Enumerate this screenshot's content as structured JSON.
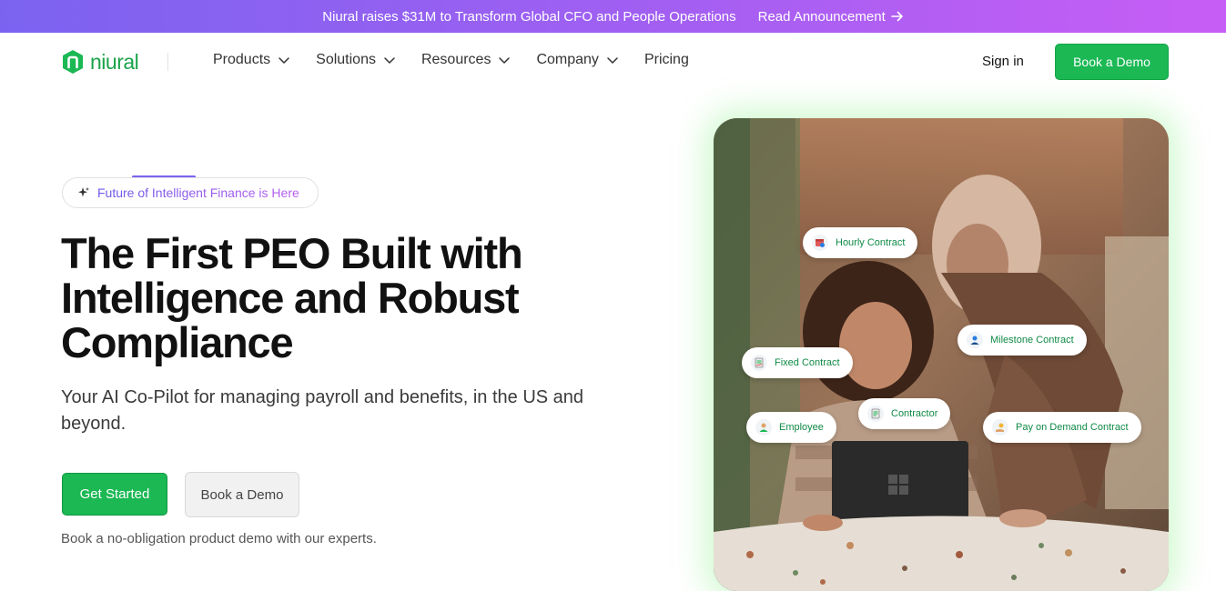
{
  "announcement": {
    "text": "Niural raises $31M to Transform Global CFO and People Operations",
    "link_label": "Read Announcement",
    "link_icon": "arrow-right-icon"
  },
  "nav": {
    "logo_text": "niural",
    "items": [
      {
        "label": "Products",
        "has_dropdown": true
      },
      {
        "label": "Solutions",
        "has_dropdown": true
      },
      {
        "label": "Resources",
        "has_dropdown": true
      },
      {
        "label": "Company",
        "has_dropdown": true
      },
      {
        "label": "Pricing",
        "has_dropdown": false
      }
    ],
    "signin_label": "Sign in",
    "demo_label": "Book a Demo"
  },
  "hero": {
    "badge_text": "Future of Intelligent Finance is Here",
    "badge_icon": "sparkle-icon",
    "title_lines": [
      "The First PEO Built with",
      "Intelligence and Robust",
      "Compliance"
    ],
    "subtitle_lines": [
      "Your AI Co-Pilot for managing payroll and benefits, in the US and",
      "beyond."
    ],
    "primary_cta": "Get Started",
    "secondary_cta": "Book a Demo",
    "note": "Book a no-obligation product demo with our experts."
  },
  "tags": [
    {
      "label": "Hourly Contract",
      "icon": "calendar-clock-icon"
    },
    {
      "label": "Milestone Contract",
      "icon": "milestone-user-icon"
    },
    {
      "label": "Fixed Contract",
      "icon": "fixed-doc-icon"
    },
    {
      "label": "Contractor",
      "icon": "contractor-doc-icon"
    },
    {
      "label": "Employee",
      "icon": "employee-icon"
    },
    {
      "label": "Pay on Demand Contract",
      "icon": "pay-hand-icon"
    }
  ],
  "colors": {
    "brand_green": "#1bb854",
    "announce_start": "#7b63f0",
    "announce_end": "#c75ef5",
    "tag_text": "#0f8a45"
  }
}
